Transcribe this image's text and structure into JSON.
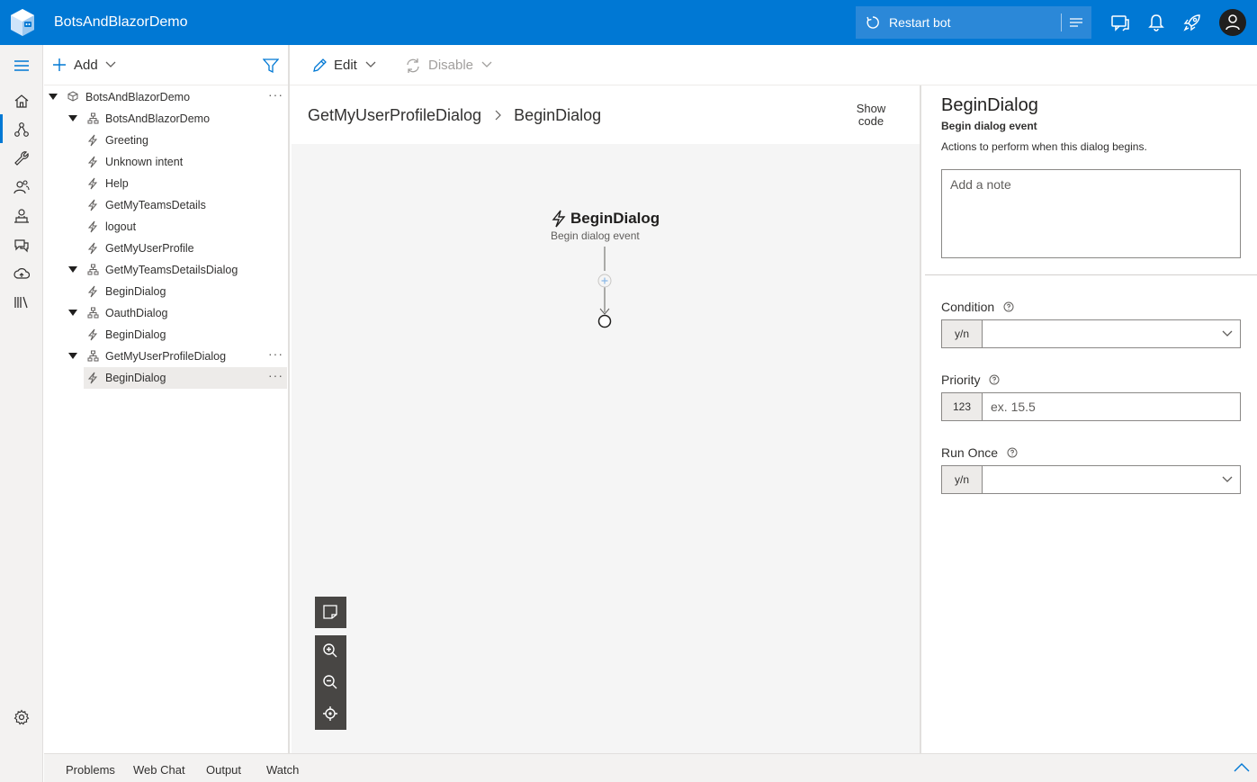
{
  "header": {
    "app_title": "BotsAndBlazorDemo",
    "restart_label": "Restart bot",
    "brand_color": "#0078d4"
  },
  "toolbar": {
    "add_label": "Add",
    "edit_label": "Edit",
    "disable_label": "Disable"
  },
  "rail": {
    "items": [
      "menu-icon",
      "home-icon",
      "design-icon",
      "wrench-icon",
      "users-icon",
      "bot-icon",
      "qna-icon",
      "publish-icon",
      "library-icon",
      "settings-icon"
    ]
  },
  "tree": {
    "items": [
      {
        "label": "BotsAndBlazorDemo",
        "kind": "bot",
        "expanded": true
      },
      {
        "label": "BotsAndBlazorDemo",
        "kind": "dialog",
        "expanded": true
      },
      {
        "label": "Greeting",
        "kind": "trigger"
      },
      {
        "label": "Unknown intent",
        "kind": "trigger"
      },
      {
        "label": "Help",
        "kind": "trigger"
      },
      {
        "label": "GetMyTeamsDetails",
        "kind": "trigger"
      },
      {
        "label": "logout",
        "kind": "trigger"
      },
      {
        "label": "GetMyUserProfile",
        "kind": "trigger"
      },
      {
        "label": "GetMyTeamsDetailsDialog",
        "kind": "dialog",
        "expanded": true
      },
      {
        "label": "BeginDialog",
        "kind": "trigger"
      },
      {
        "label": "OauthDialog",
        "kind": "dialog",
        "expanded": true
      },
      {
        "label": "BeginDialog",
        "kind": "trigger"
      },
      {
        "label": "GetMyUserProfileDialog",
        "kind": "dialog",
        "expanded": true
      },
      {
        "label": "BeginDialog",
        "kind": "trigger",
        "selected": true
      }
    ],
    "more_label": "···"
  },
  "canvas": {
    "breadcrumb": [
      "GetMyUserProfileDialog",
      "BeginDialog"
    ],
    "show_code": [
      "Show",
      "code"
    ],
    "node_title": "BeginDialog",
    "node_subtitle": "Begin dialog event"
  },
  "panel": {
    "title": "BeginDialog",
    "subtitle": "Begin dialog event",
    "description": "Actions to perform when this dialog begins.",
    "note_placeholder": "Add a note",
    "condition": {
      "label": "Condition",
      "type": "y/n",
      "value": ""
    },
    "priority": {
      "label": "Priority",
      "type": "123",
      "placeholder": "ex. 15.5"
    },
    "run_once": {
      "label": "Run Once",
      "type": "y/n",
      "value": ""
    }
  },
  "bottom": {
    "tabs": [
      "Problems",
      "Web Chat",
      "Output",
      "Watch"
    ]
  }
}
